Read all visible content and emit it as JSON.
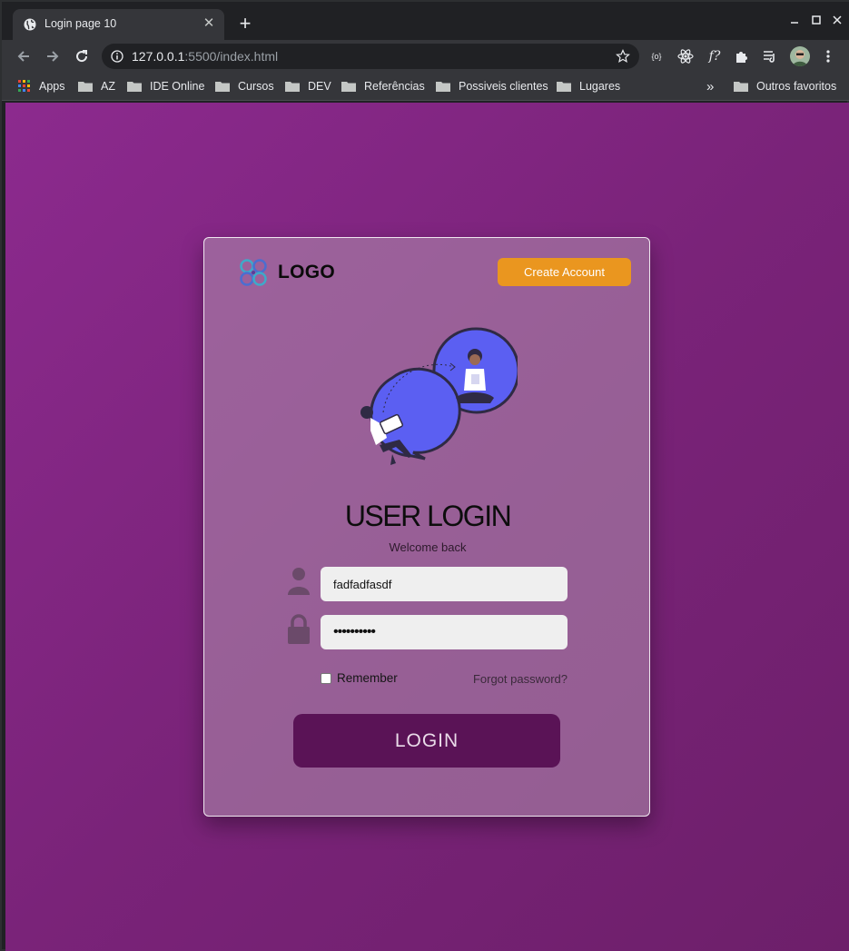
{
  "browser": {
    "tab_title": "Login page 10",
    "url_host": "127.0.0.1",
    "url_rest": ":5500/index.html",
    "bookmarks": [
      "Apps",
      "AZ",
      "IDE Online",
      "Cursos",
      "DEV",
      "Referências",
      "Possiveis clientes",
      "Lugares"
    ],
    "other_bookmarks": "Outros favoritos",
    "overflow": "»",
    "extension_labels": [
      "{o}",
      "f?"
    ]
  },
  "page": {
    "logo_text": "LOGO",
    "create_account": "Create Account",
    "heading": "USER LOGIN",
    "subtitle": "Welcome back",
    "username_value": "fadfadfasdf",
    "password_mask": "••••••••••",
    "remember_label": "Remember",
    "forgot_label": "Forgot password?",
    "login_label": "LOGIN"
  },
  "colors": {
    "background": "#7f2580",
    "accent_orange": "#ea961f",
    "login_button": "#5a1356",
    "illustration_blue": "#5b5ff2"
  },
  "icons": [
    "globe-icon",
    "close-icon",
    "plus-icon",
    "minimize-icon",
    "maximize-icon",
    "window-close-icon",
    "back-icon",
    "forward-icon",
    "reload-icon",
    "info-icon",
    "star-icon",
    "react-icon",
    "puzzle-icon",
    "playlist-icon",
    "menu-icon",
    "folder-icon",
    "apps-grid-icon",
    "user-icon",
    "lock-icon"
  ]
}
